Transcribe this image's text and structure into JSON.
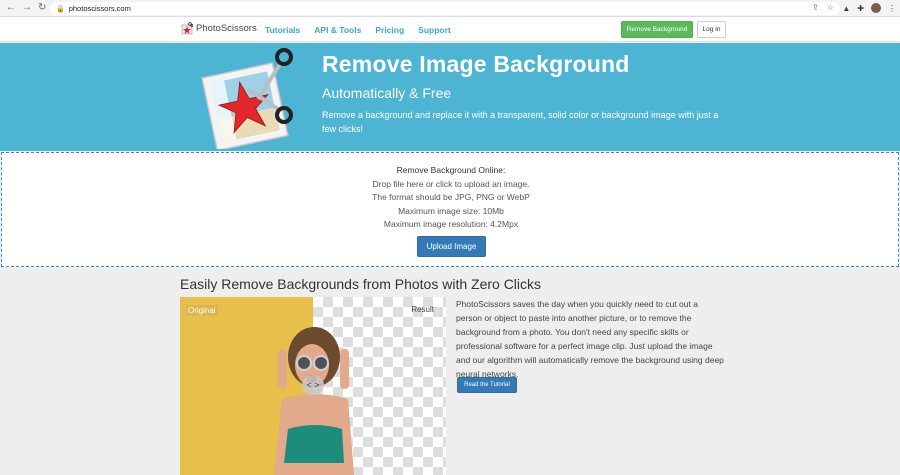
{
  "browser": {
    "url": "photoscissors.com"
  },
  "header": {
    "logo_text": "PhotoScissors",
    "nav": [
      "Tutorials",
      "API & Tools",
      "Pricing",
      "Support"
    ],
    "remove_bg_button": "Remove Background",
    "login_button": "Log In"
  },
  "hero": {
    "title": "Remove Image Background",
    "subtitle": "Automatically & Free",
    "description": "Remove a background and replace it with a transparent, solid color or background image with just a few clicks!"
  },
  "dropzone": {
    "heading": "Remove Background Online:",
    "line1": "Drop file here or click to upload an image.",
    "line2": "The format should be JPG, PNG or WebP",
    "line3": "Maximum image size: 10Mb",
    "line4": "Maximum image resolution: 4.2Mpx",
    "upload_button": "Upload Image"
  },
  "section": {
    "title": "Easily Remove Backgrounds from Photos with Zero Clicks",
    "original_label": "Original",
    "result_label": "Result",
    "slider_glyph": "< >",
    "description": "PhotoScissors saves the day when you quickly need to cut out a person or object to paste into another picture, or to remove the background from a photo. You don't need any specific skills or professional software for a perfect image clip. Just upload the image and our algorithm will automatically remove the background using deep neural networks.",
    "tutorial_button": "Read the Tutorial"
  },
  "colors": {
    "hero_bg": "#4db4d3",
    "nav_link": "#3aa7c9",
    "green_button": "#5cb85c",
    "blue_button": "#337ab7"
  }
}
